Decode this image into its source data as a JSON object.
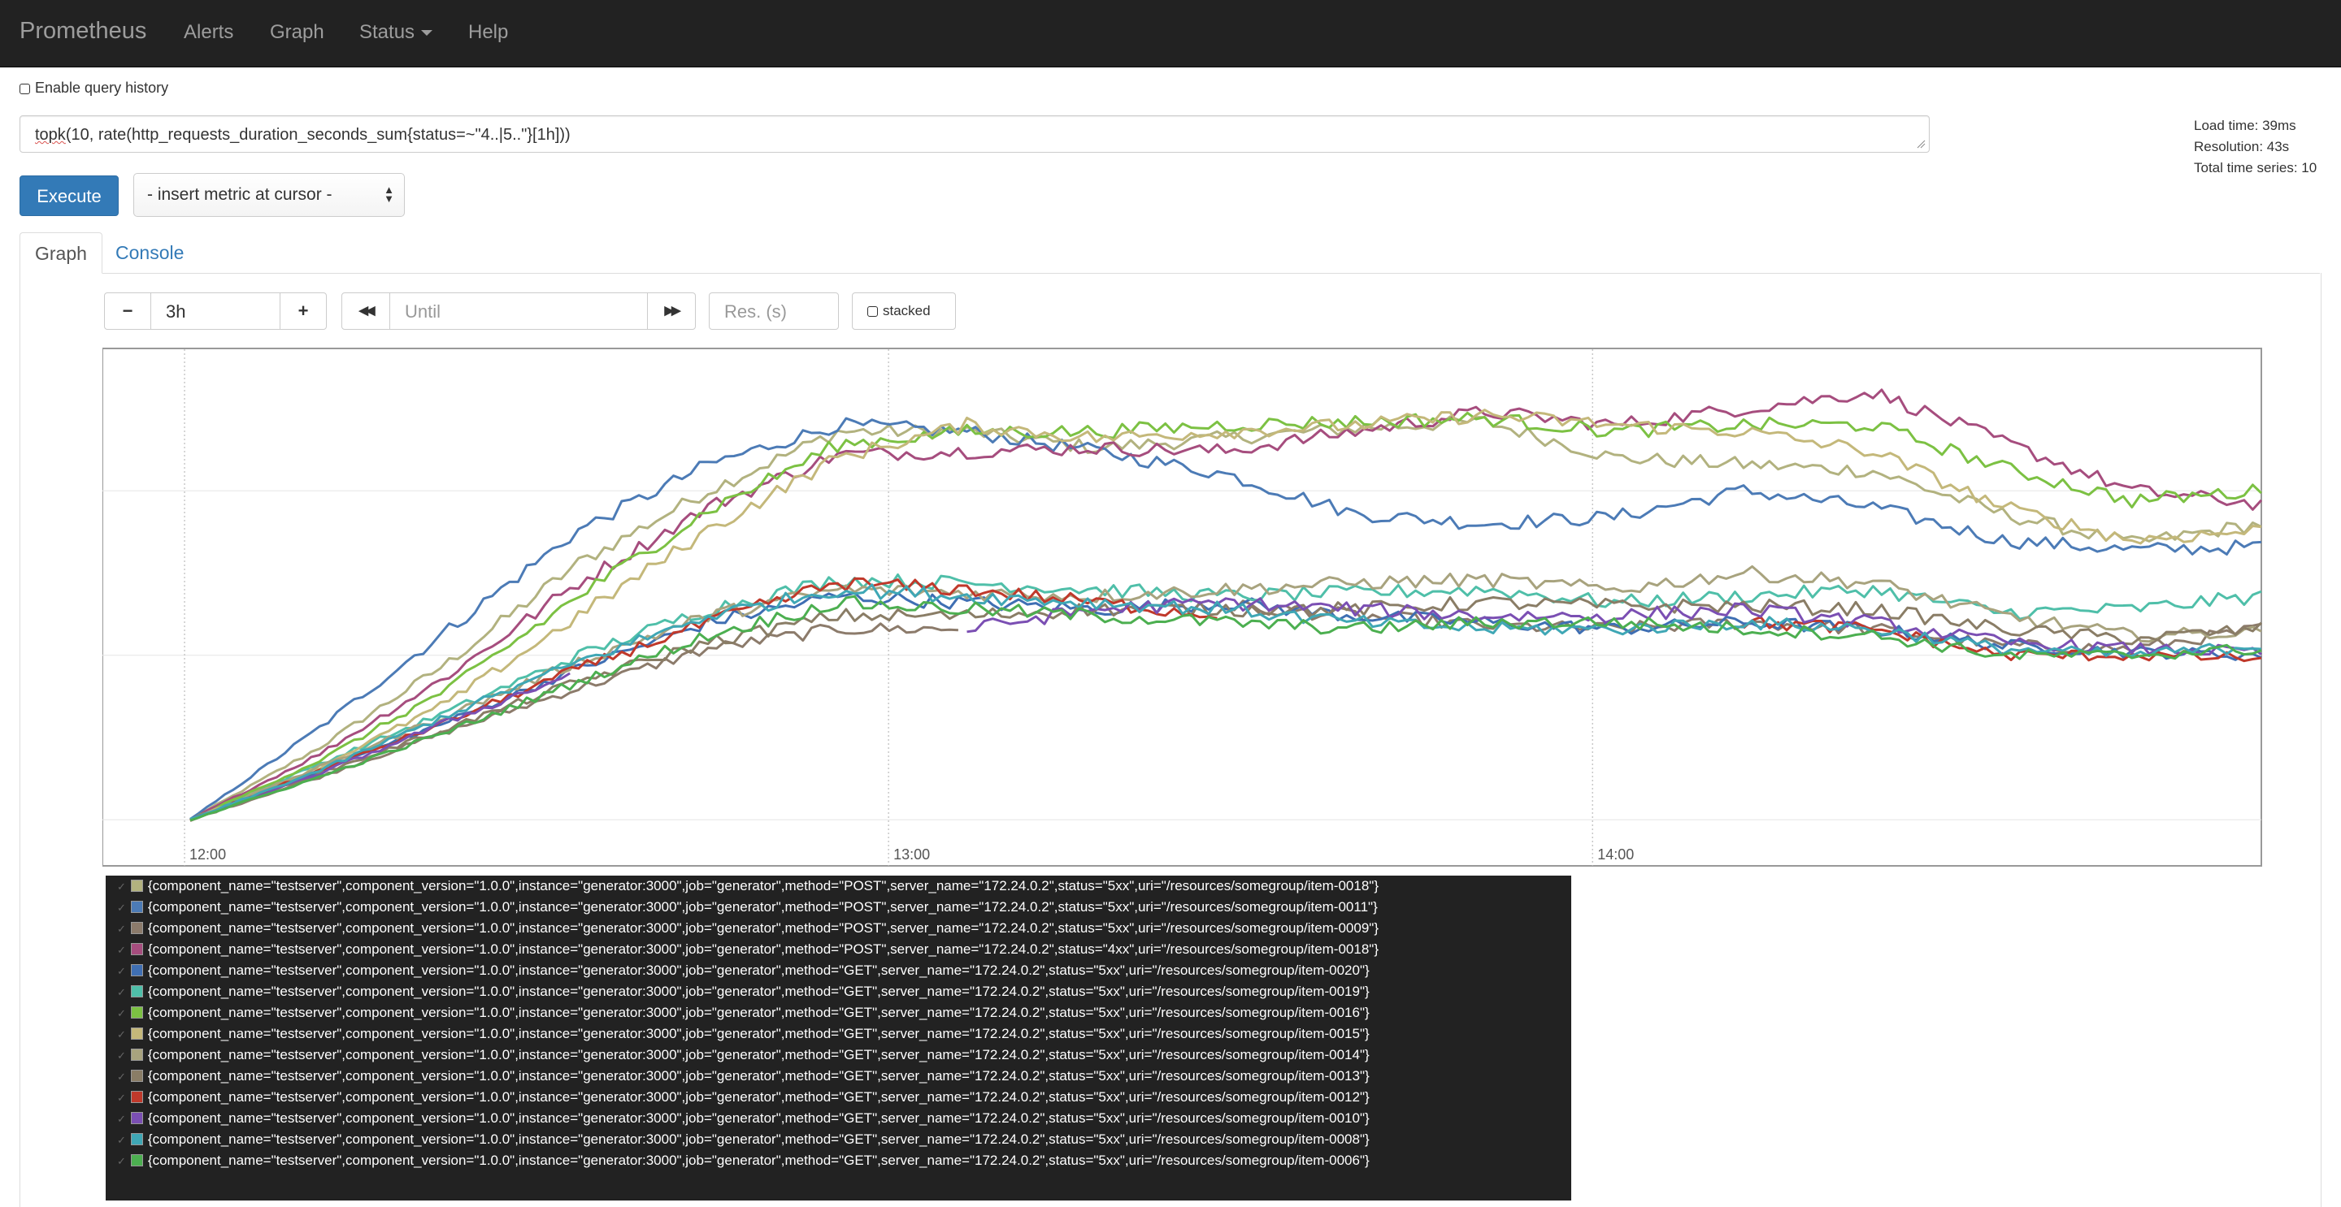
{
  "navbar": {
    "brand": "Prometheus",
    "items": [
      "Alerts",
      "Graph",
      "Status",
      "Help"
    ]
  },
  "query_history_label": "Enable query history",
  "expression": {
    "prefix": "topk",
    "rest": "(10, rate(http_requests_duration_seconds_sum{status=~\"4..|5..\"}[1h]))"
  },
  "stats": {
    "load_time": "Load time: 39ms",
    "resolution": "Resolution: 43s",
    "total_series": "Total time series: 10"
  },
  "execute_label": "Execute",
  "metric_select": "- insert metric at cursor -",
  "tabs": [
    "Graph",
    "Console"
  ],
  "controls": {
    "minus": "−",
    "range": "3h",
    "plus": "+",
    "back": "◀◀",
    "until_placeholder": "Until",
    "forward": "▶▶",
    "res_placeholder": "Res. (s)",
    "stacked_label": "stacked"
  },
  "colors": {
    "navbar_bg": "#222222",
    "primary": "#337ab7",
    "legend_bg": "#222222"
  },
  "chart_data": {
    "type": "line",
    "x_ticks": [
      "12:00",
      "13:00",
      "14:00"
    ],
    "y_ticks": [
      "0",
      "0.05",
      "0.1"
    ],
    "ylim": [
      -0.014,
      0.143
    ],
    "grid": true,
    "x_time_range": [
      "11:53",
      "14:57"
    ],
    "series": [
      {
        "color": "#b2b27f",
        "label": "{component_name=\"testserver\",component_version=\"1.0.0\",instance=\"generator:3000\",job=\"generator\",method=\"POST\",server_name=\"172.24.0.2\",status=\"5xx\",uri=\"/resources/somegroup/item-0018\"}",
        "values": [
          0,
          0.022,
          0.048,
          0.078,
          0.1,
          0.118,
          0.118,
          0.113,
          0.116,
          0.119,
          0.121,
          0.11,
          0.108,
          0.106,
          0.093,
          0.084,
          0.09
        ]
      },
      {
        "color": "#4c7bb6",
        "label": "{component_name=\"testserver\",component_version=\"1.0.0\",instance=\"generator:3000\",job=\"generator\",method=\"POST\",server_name=\"172.24.0.2\",status=\"5xx\",uri=\"/resources/somegroup/item-0011\"}",
        "values": [
          0,
          0.028,
          0.058,
          0.088,
          0.108,
          0.12,
          0.118,
          0.112,
          0.105,
          0.093,
          0.09,
          0.092,
          0.1,
          0.095,
          0.085,
          0.082,
          0.083
        ]
      },
      {
        "color": "#8c7b6b",
        "label": "{component_name=\"testserver\",component_version=\"1.0.0\",instance=\"generator:3000\",job=\"generator\",method=\"POST\",server_name=\"172.24.0.2\",status=\"5xx\",uri=\"/resources/somegroup/item-0009\"}",
        "values": [
          0,
          0.013,
          0.027,
          0.04,
          0.052,
          0.058,
          0.058,
          null,
          0.065,
          0.062,
          0.059,
          0.058,
          0.06,
          0.058,
          0.053,
          0.052,
          0.058
        ]
      },
      {
        "color": "#a64d7e",
        "label": "{component_name=\"testserver\",component_version=\"1.0.0\",instance=\"generator:3000\",job=\"generator\",method=\"POST\",server_name=\"172.24.0.2\",status=\"4xx\",uri=\"/resources/somegroup/item-0018\"}",
        "values": [
          0,
          0.02,
          0.044,
          0.072,
          0.095,
          0.111,
          0.112,
          0.113,
          0.112,
          0.118,
          0.124,
          0.12,
          0.125,
          0.13,
          0.115,
          0.1,
          0.096
        ]
      },
      {
        "color": "#3f6fb3",
        "label": "{component_name=\"testserver\",component_version=\"1.0.0\",instance=\"generator:3000\",job=\"generator\",method=\"GET\",server_name=\"172.24.0.2\",status=\"5xx\",uri=\"/resources/somegroup/item-0020\"}",
        "values": [
          0,
          0.015,
          0.03,
          0.046,
          0.06,
          0.068,
          0.066,
          0.064,
          0.066,
          0.062,
          0.06,
          0.058,
          0.06,
          0.058,
          0.053,
          0.051,
          0.05
        ]
      },
      {
        "color": "#4fbfa9",
        "label": "{component_name=\"testserver\",component_version=\"1.0.0\",instance=\"generator:3000\",job=\"generator\",method=\"GET\",server_name=\"172.24.0.2\",status=\"5xx\",uri=\"/resources/somegroup/item-0019\"}",
        "values": [
          0,
          0.017,
          0.033,
          0.05,
          0.064,
          0.073,
          0.072,
          0.07,
          0.068,
          0.069,
          0.07,
          0.066,
          0.068,
          0.07,
          0.063,
          0.064,
          0.068
        ]
      },
      {
        "color": "#7cc143",
        "label": "{component_name=\"testserver\",component_version=\"1.0.0\",instance=\"generator:3000\",job=\"generator\",method=\"GET\",server_name=\"172.24.0.2\",status=\"5xx\",uri=\"/resources/somegroup/item-0016\"}",
        "values": [
          0,
          0.018,
          0.04,
          0.068,
          0.094,
          0.114,
          0.118,
          0.118,
          0.12,
          0.121,
          0.122,
          0.118,
          0.12,
          0.12,
          0.107,
          0.097,
          0.1
        ]
      },
      {
        "color": "#c4b87a",
        "label": "{component_name=\"testserver\",component_version=\"1.0.0\",instance=\"generator:3000\",job=\"generator\",method=\"GET\",server_name=\"172.24.0.2\",status=\"5xx\",uri=\"/resources/somegroup/item-0015\"}",
        "values": [
          0,
          0.016,
          0.036,
          0.062,
          0.088,
          0.11,
          0.12,
          0.116,
          0.118,
          0.12,
          0.123,
          0.12,
          0.118,
          0.112,
          0.095,
          0.085,
          0.088
        ]
      },
      {
        "color": "#a8a37e",
        "label": "{component_name=\"testserver\",component_version=\"1.0.0\",instance=\"generator:3000\",job=\"generator\",method=\"GET\",server_name=\"172.24.0.2\",status=\"5xx\",uri=\"/resources/somegroup/item-0014\"}",
        "values": [
          0,
          0.016,
          0.032,
          0.048,
          0.062,
          0.07,
          0.069,
          0.068,
          0.07,
          0.072,
          0.073,
          0.07,
          0.075,
          0.072,
          0.062,
          0.056,
          0.057
        ]
      },
      {
        "color": "#8a7d66",
        "label": "{component_name=\"testserver\",component_version=\"1.0.0\",instance=\"generator:3000\",job=\"generator\",method=\"GET\",server_name=\"172.24.0.2\",status=\"5xx\",uri=\"/resources/somegroup/item-0013\"}",
        "values": [
          0,
          0.014,
          0.028,
          0.042,
          0.054,
          0.062,
          0.062,
          0.064,
          0.064,
          0.064,
          0.066,
          0.065,
          0.065,
          0.064,
          0.058,
          0.055,
          0.058
        ]
      },
      {
        "color": "#c0392b",
        "label": "{component_name=\"testserver\",component_version=\"1.0.0\",instance=\"generator:3000\",job=\"generator\",method=\"GET\",server_name=\"172.24.0.2\",status=\"5xx\",uri=\"/resources/somegroup/item-0012\"}",
        "values": [
          0,
          0.015,
          0.03,
          0.046,
          0.06,
          0.072,
          0.07,
          0.066,
          0.062,
          null,
          null,
          null,
          0.06,
          0.058,
          0.05,
          0.05,
          0.049
        ]
      },
      {
        "color": "#7b4fb3",
        "label": "{component_name=\"testserver\",component_version=\"1.0.0\",instance=\"generator:3000\",job=\"generator\",method=\"GET\",server_name=\"172.24.0.2\",status=\"5xx\",uri=\"/resources/somegroup/item-0010\"}",
        "values": [
          0,
          0.014,
          0.03,
          0.045,
          null,
          null,
          0.058,
          0.064,
          0.066,
          0.064,
          0.062,
          0.062,
          0.064,
          0.06,
          0.054,
          0.052,
          0.051
        ]
      },
      {
        "color": "#3fa7b5",
        "label": "{component_name=\"testserver\",component_version=\"1.0.0\",instance=\"generator:3000\",job=\"generator\",method=\"GET\",server_name=\"172.24.0.2\",status=\"5xx\",uri=\"/resources/somegroup/item-0008\"}",
        "values": [
          0,
          0.015,
          0.032,
          0.048,
          0.062,
          0.07,
          0.068,
          0.066,
          0.064,
          0.06,
          0.058,
          0.058,
          0.06,
          0.058,
          0.052,
          0.05,
          0.053
        ]
      },
      {
        "color": "#4caf50",
        "label": "{component_name=\"testserver\",component_version=\"1.0.0\",instance=\"generator:3000\",job=\"generator\",method=\"GET\",server_name=\"172.24.0.2\",status=\"5xx\",uri=\"/resources/somegroup/item-0006\"}",
        "values": [
          0,
          0.013,
          0.027,
          0.042,
          0.056,
          0.066,
          0.064,
          0.062,
          0.06,
          0.058,
          0.06,
          0.06,
          0.058,
          0.056,
          0.05,
          0.05,
          0.052
        ]
      }
    ]
  }
}
